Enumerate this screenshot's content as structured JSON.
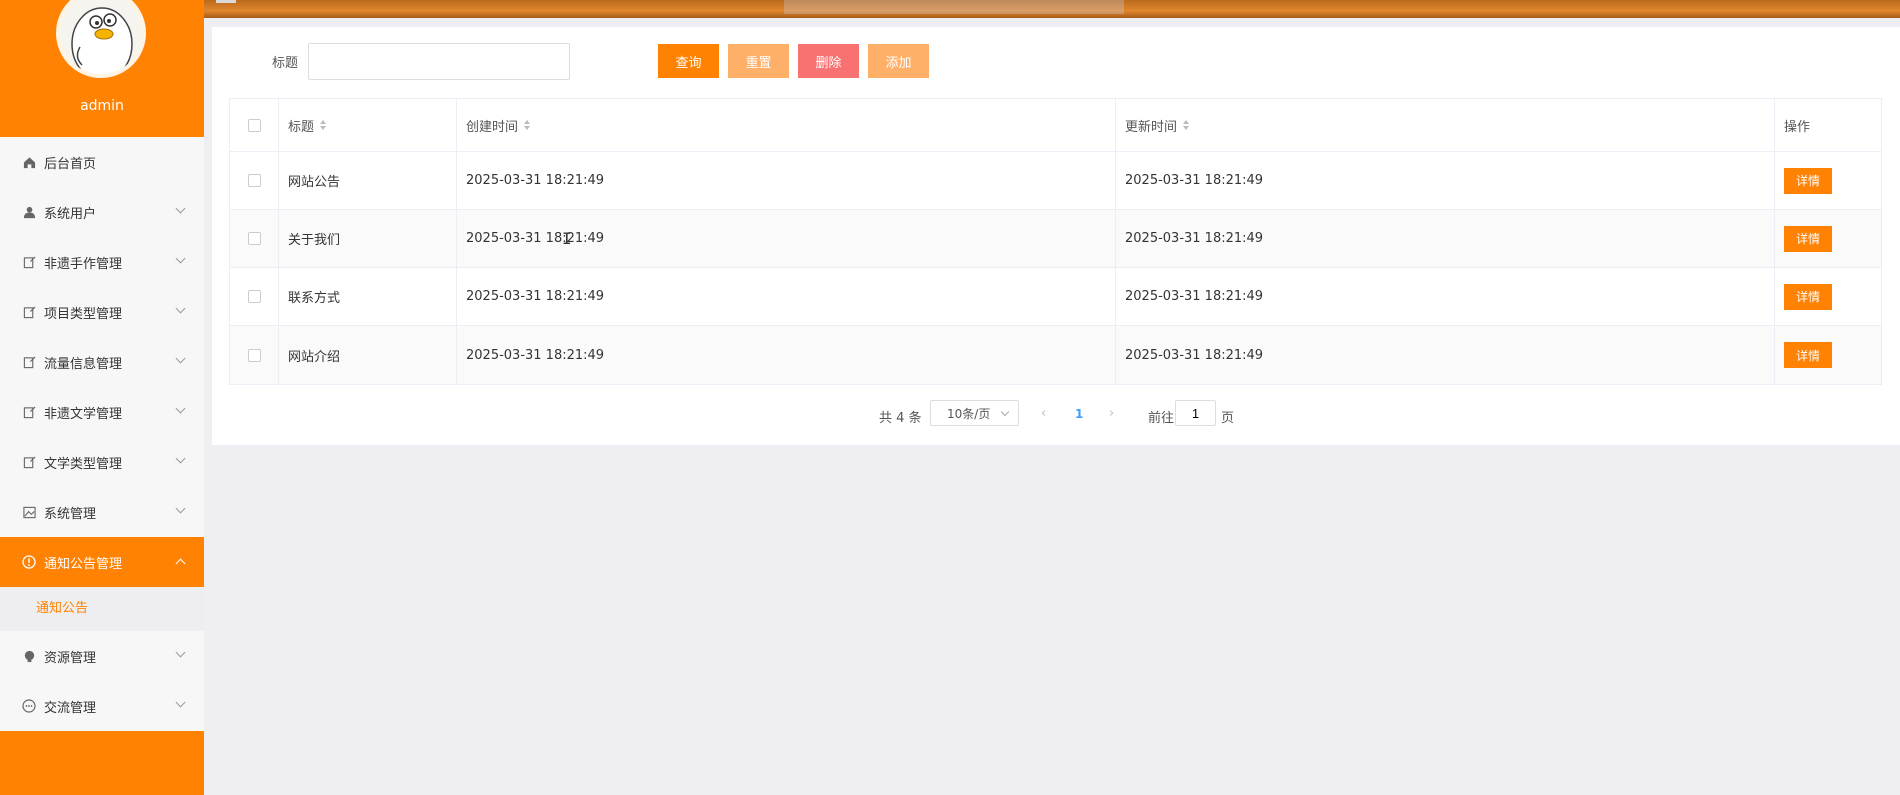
{
  "user": {
    "name": "admin"
  },
  "sidebar": {
    "items": [
      {
        "label": "后台首页",
        "icon": "home-icon",
        "expandable": false
      },
      {
        "label": "系统用户",
        "icon": "user-icon",
        "expandable": true
      },
      {
        "label": "非遗手作管理",
        "icon": "doc-edit-icon",
        "expandable": true
      },
      {
        "label": "项目类型管理",
        "icon": "doc-edit-icon",
        "expandable": true
      },
      {
        "label": "流量信息管理",
        "icon": "doc-edit-icon",
        "expandable": true
      },
      {
        "label": "非遗文学管理",
        "icon": "doc-edit-icon",
        "expandable": true
      },
      {
        "label": "文学类型管理",
        "icon": "doc-edit-icon",
        "expandable": true
      },
      {
        "label": "系统管理",
        "icon": "image-icon",
        "expandable": true
      },
      {
        "label": "通知公告管理",
        "icon": "info-circle-icon",
        "expandable": true,
        "active": true
      },
      {
        "label": "资源管理",
        "icon": "bulb-icon",
        "expandable": true
      },
      {
        "label": "交流管理",
        "icon": "chat-icon",
        "expandable": true
      }
    ],
    "submenu": {
      "label": "通知公告"
    }
  },
  "search": {
    "label": "标题",
    "value": "",
    "placeholder": ""
  },
  "toolbar": {
    "query_label": "查询",
    "reset_label": "重置",
    "delete_label": "删除",
    "add_label": "添加"
  },
  "table": {
    "columns": [
      "标题",
      "创建时间",
      "更新时间",
      "操作"
    ],
    "rows": [
      {
        "title": "网站公告",
        "created": "2025-03-31 18:21:49",
        "updated": "2025-03-31 18:21:49",
        "action": "详情"
      },
      {
        "title": "关于我们",
        "created": "2025-03-31 18:21:49",
        "updated": "2025-03-31 18:21:49",
        "action": "详情"
      },
      {
        "title": "联系方式",
        "created": "2025-03-31 18:21:49",
        "updated": "2025-03-31 18:21:49",
        "action": "详情"
      },
      {
        "title": "网站介绍",
        "created": "2025-03-31 18:21:49",
        "updated": "2025-03-31 18:21:49",
        "action": "详情"
      }
    ]
  },
  "pagination": {
    "total_text": "共 4 条",
    "page_size": "10条/页",
    "current_page": "1",
    "goto_label": "前往",
    "goto_value": "1",
    "goto_unit": "页"
  },
  "colors": {
    "accent": "#ff8203",
    "reset": "#ffb068",
    "delete": "#f87272",
    "link": "#409eff"
  }
}
